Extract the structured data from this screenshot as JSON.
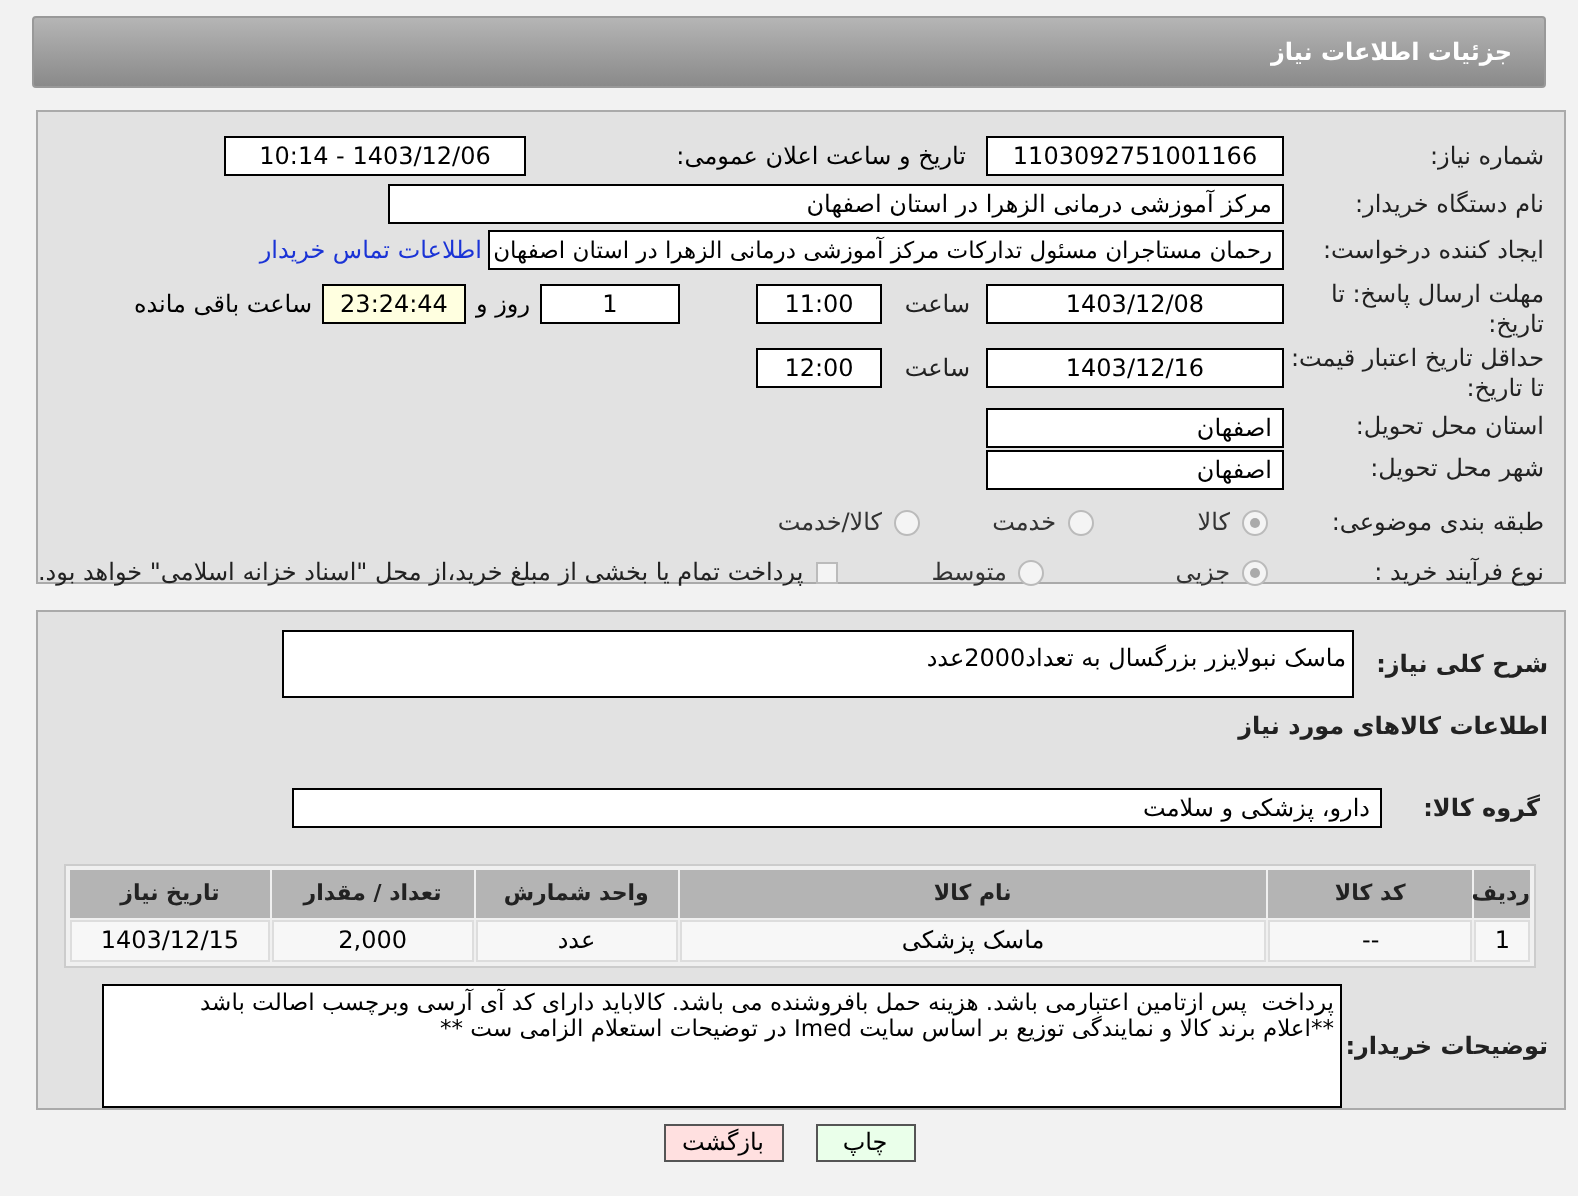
{
  "header": {
    "title": "جزئیات اطلاعات نیاز"
  },
  "need_number": {
    "label": "شماره نیاز:",
    "value": "1103092751001166"
  },
  "announce": {
    "label": "تاریخ و ساعت اعلان عمومی:",
    "value": "1403/12/06 - 10:14"
  },
  "buyer_org": {
    "label": "نام دستگاه خریدار:",
    "value": "مرکز آموزشی درمانی الزهرا در استان اصفهان"
  },
  "requester": {
    "label": "ایجاد کننده درخواست:",
    "value": "رحمان مستاجران مسئول تداركات مرکز آموزشی درمانی الزهرا در استان اصفهان",
    "link": "اطلاعات تماس خریدار"
  },
  "deadline": {
    "label": "مهلت ارسال پاسخ: تا تاریخ:",
    "date": "1403/12/08",
    "time_label": "ساعت",
    "time": "11:00",
    "days": "1",
    "days_suffix": "روز و",
    "remaining": "23:24:44",
    "remaining_suffix": "ساعت باقی مانده"
  },
  "price_validity": {
    "label": "حداقل تاریخ اعتبار قیمت: تا تاریخ:",
    "date": "1403/12/16",
    "time_label": "ساعت",
    "time": "12:00"
  },
  "province": {
    "label": "استان محل تحویل:",
    "value": "اصفهان"
  },
  "city": {
    "label": "شهر محل تحویل:",
    "value": "اصفهان"
  },
  "category": {
    "label": "طبقه بندی موضوعی:",
    "options": [
      {
        "label": "کالا",
        "selected": true
      },
      {
        "label": "خدمت",
        "selected": false
      },
      {
        "label": "کالا/خدمت",
        "selected": false
      }
    ]
  },
  "process": {
    "label": "نوع فرآیند خرید :",
    "options": [
      {
        "label": "جزیی",
        "selected": true
      },
      {
        "label": "متوسط",
        "selected": false
      }
    ],
    "checkbox": {
      "label": "پرداخت تمام یا بخشی از مبلغ خرید،از محل \"اسناد خزانه اسلامی\" خواهد بود.",
      "checked": false
    }
  },
  "description": {
    "label": "شرح کلی نیاز:",
    "value": "ماسک نبولایزر بزرگسال به تعداد2000عدد"
  },
  "goods_title": "اطلاعات کالاهای مورد نیاز",
  "goods_group": {
    "label": "گروه کالا:",
    "value": "دارو، پزشکی و سلامت"
  },
  "table": {
    "columns": [
      "ردیف",
      "کد کالا",
      "نام کالا",
      "واحد شمارش",
      "تعداد / مقدار",
      "تاریخ نیاز"
    ],
    "rows": [
      [
        "1",
        "--",
        "ماسک پزشکی",
        "عدد",
        "2,000",
        "1403/12/15"
      ]
    ]
  },
  "buyer_notes": {
    "label": "توضیحات خریدار:",
    "value": "پرداخت  پس ازتامین اعتبارمی باشد. هزینه حمل بافروشنده می باشد. کالاباید دارای کد آی آرسی وبرچسب اصالت باشد\n**اعلام برند کالا و نمایندگی توزیع بر اساس سایت Imed در توضیحات استعلام الزامی ست **"
  },
  "buttons": [
    {
      "label": "چاپ",
      "kind": "print"
    },
    {
      "label": "بازگشت",
      "kind": "back"
    }
  ]
}
